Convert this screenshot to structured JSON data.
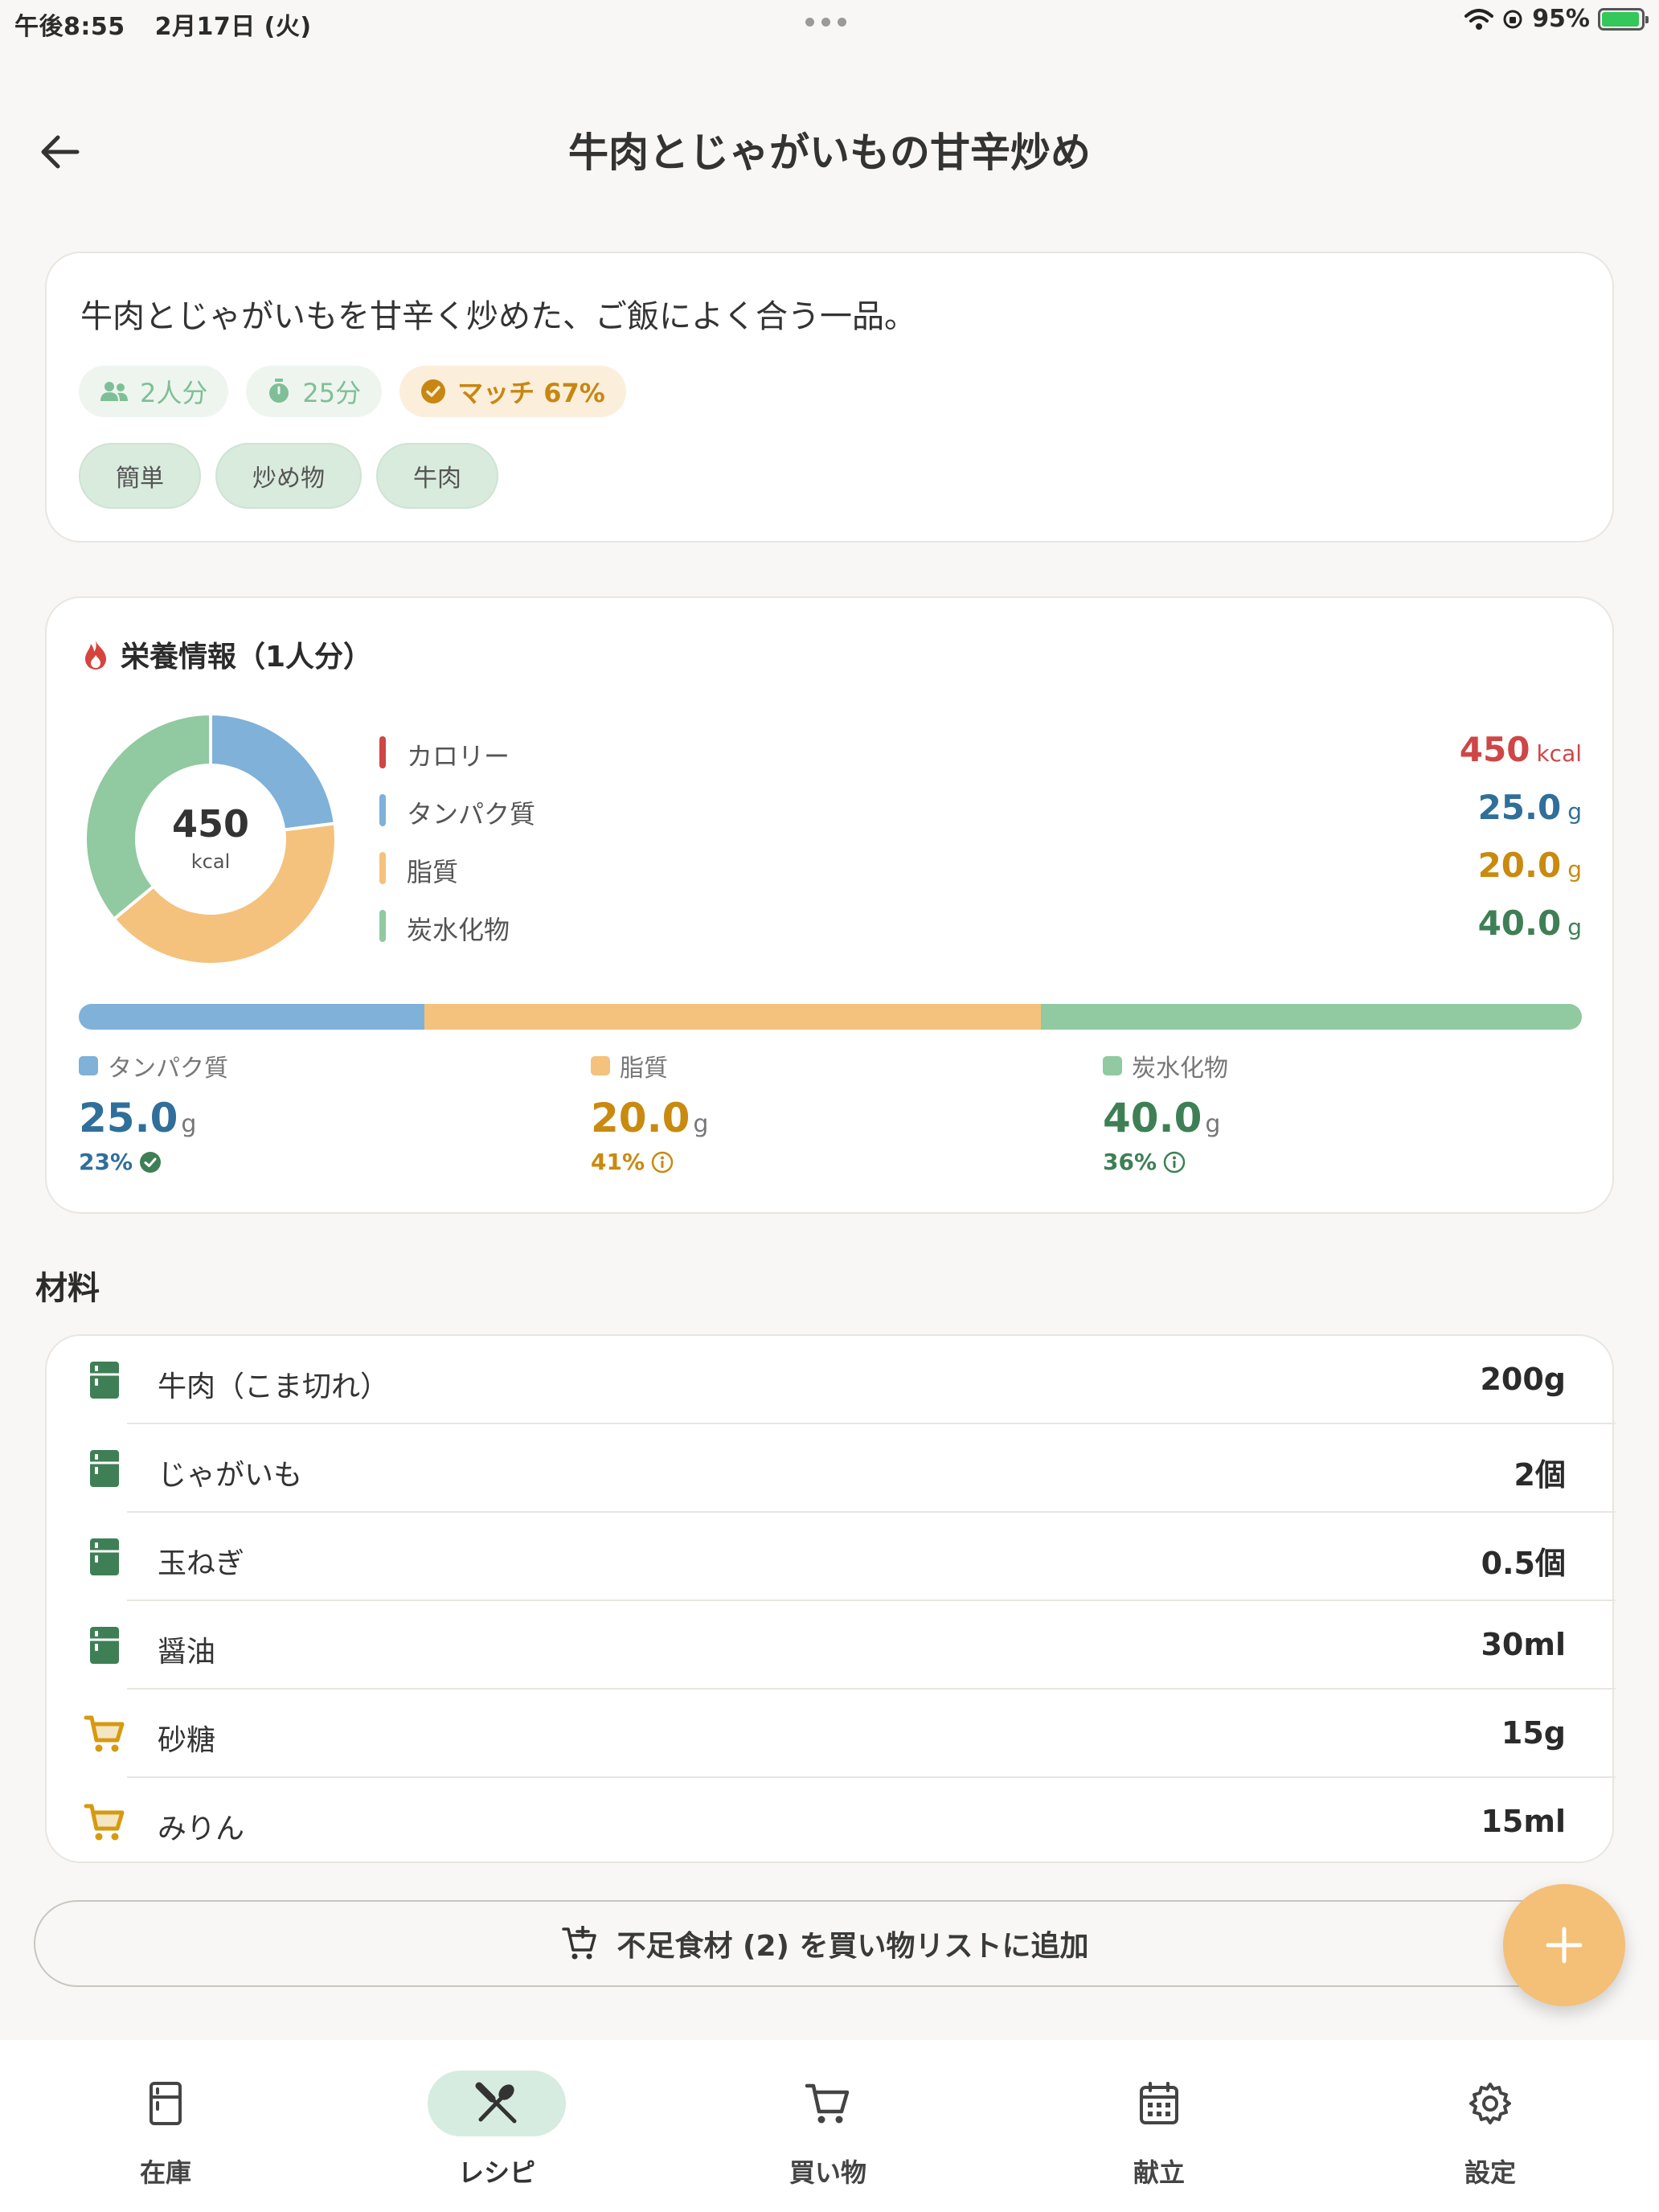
{
  "status_bar": {
    "time": "午後8:55",
    "date": "2月17日 (火)",
    "battery": "95%"
  },
  "header": {
    "title": "牛肉とじゃがいもの甘辛炒め",
    "back_icon": "arrow-left-icon"
  },
  "recipe": {
    "description": "牛肉とじゃがいもを甘辛く炒めた、ご飯によく合う一品。",
    "servings": "2人分",
    "time": "25分",
    "match": "マッチ 67%",
    "tags": [
      "簡単",
      "炒め物",
      "牛肉"
    ]
  },
  "nutrition": {
    "title": "栄養情報（1人分）",
    "donut_value": "450",
    "donut_unit": "kcal",
    "legend": [
      {
        "label": "カロリー",
        "value": "450",
        "unit": "kcal",
        "color": "#cf4646"
      },
      {
        "label": "タンパク質",
        "value": "25.0",
        "unit": "g",
        "color": "#2f6f9a"
      },
      {
        "label": "脂質",
        "value": "20.0",
        "unit": "g",
        "color": "#c98a10"
      },
      {
        "label": "炭水化物",
        "value": "40.0",
        "unit": "g",
        "color": "#3f7f55"
      }
    ],
    "macros": [
      {
        "name": "タンパク質",
        "value": "25.0",
        "unit": "g",
        "percent": "23%",
        "status": "check-circle-icon",
        "color": "#2f6f9a",
        "swatch": "#7fb1d9"
      },
      {
        "name": "脂質",
        "value": "20.0",
        "unit": "g",
        "percent": "41%",
        "status": "info-icon",
        "color": "#c98a10",
        "swatch": "#f4c27c"
      },
      {
        "name": "炭水化物",
        "value": "40.0",
        "unit": "g",
        "percent": "36%",
        "status": "info-icon",
        "color": "#3f7f55",
        "swatch": "#91c9a0"
      }
    ]
  },
  "chart_data": {
    "type": "pie",
    "categories": [
      "タンパク質",
      "脂質",
      "炭水化物"
    ],
    "values": [
      23,
      41,
      36
    ],
    "colors": [
      "#7fb1d9",
      "#f4c27c",
      "#91c9a0"
    ],
    "center_label": "450 kcal"
  },
  "ingredients": {
    "title": "材料",
    "items": [
      {
        "name": "牛肉（こま切れ）",
        "qty": "200g",
        "icon": "fridge-icon"
      },
      {
        "name": "じゃがいも",
        "qty": "2個",
        "icon": "fridge-icon"
      },
      {
        "name": "玉ねぎ",
        "qty": "0.5個",
        "icon": "fridge-icon"
      },
      {
        "name": "醤油",
        "qty": "30ml",
        "icon": "fridge-icon"
      },
      {
        "name": "砂糖",
        "qty": "15g",
        "icon": "cart-icon"
      },
      {
        "name": "みりん",
        "qty": "15ml",
        "icon": "cart-icon"
      }
    ],
    "add_button": "不足食材 (2) を買い物リストに追加"
  },
  "nav": {
    "items": [
      {
        "label": "在庫",
        "icon": "fridge-icon",
        "active": false
      },
      {
        "label": "レシピ",
        "icon": "utensils-icon",
        "active": true
      },
      {
        "label": "買い物",
        "icon": "cart-icon",
        "active": false
      },
      {
        "label": "献立",
        "icon": "calendar-icon",
        "active": false
      },
      {
        "label": "設定",
        "icon": "gear-icon",
        "active": false
      }
    ]
  },
  "colors": {
    "background": "#f8f7f5",
    "accent_green": "#3f7f55",
    "accent_orange": "#c98a10",
    "fab": "#f4bf76",
    "calorie_red": "#cf4646",
    "protein_blue": "#2f6f9a"
  }
}
